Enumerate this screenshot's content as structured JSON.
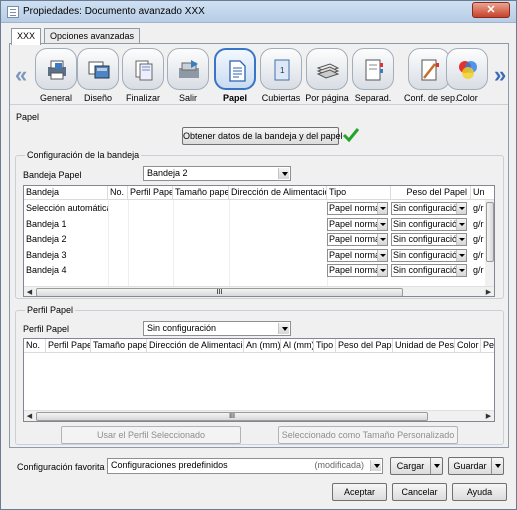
{
  "window": {
    "title": "Propiedades: Documento avanzado XXX",
    "close_label": "✕"
  },
  "tabs": [
    {
      "label": "XXX"
    },
    {
      "label": "Opciones avanzadas"
    }
  ],
  "icons": [
    {
      "label": "General",
      "icon": "printer-icon"
    },
    {
      "label": "Diseño",
      "icon": "layout-icon"
    },
    {
      "label": "Finalizar",
      "icon": "finishing-icon"
    },
    {
      "label": "Salir",
      "icon": "output-icon"
    },
    {
      "label": "Papel",
      "icon": "paper-icon"
    },
    {
      "label": "Cubiertas",
      "icon": "covers-icon"
    },
    {
      "label": "Por página",
      "icon": "per-page-icon"
    },
    {
      "label": "Separad.",
      "icon": "separator-icon"
    },
    {
      "label": "Conf. de sep.",
      "icon": "separator-settings-icon"
    },
    {
      "label": "Color",
      "icon": "color-icon"
    }
  ],
  "paper": {
    "section_label": "Papel",
    "get_tray_button": "Obtener datos de la bandeja y del papel",
    "tray_config_label": "Configuración de la bandeja",
    "tray_paper_label": "Bandeja Papel",
    "tray_paper_value": "Bandeja  2",
    "tray_columns": [
      "Bandeja",
      "No.",
      "Perfil Papel",
      "Tamaño papel",
      "Dirección de Alimentación",
      "Tipo",
      "Peso del Papel",
      "Un"
    ],
    "tray_rows": [
      {
        "bandeja": "Selección automática",
        "tipo": "Papel normal",
        "peso": "Sin configuración",
        "unidad": "g/r"
      },
      {
        "bandeja": "Bandeja 1",
        "tipo": "Papel normal",
        "peso": "Sin configuración",
        "unidad": "g/r"
      },
      {
        "bandeja": "Bandeja 2",
        "tipo": "Papel normal",
        "peso": "Sin configuración",
        "unidad": "g/r"
      },
      {
        "bandeja": "Bandeja 3",
        "tipo": "Papel normal",
        "peso": "Sin configuración",
        "unidad": "g/r"
      },
      {
        "bandeja": "Bandeja 4",
        "tipo": "Papel normal",
        "peso": "Sin configuración",
        "unidad": "g/r"
      }
    ],
    "scroll_grip": "III"
  },
  "profile": {
    "section_label": "Perfil Papel",
    "profile_label": "Perfil Papel",
    "profile_value": "Sin configuración",
    "columns": [
      "No.",
      "Perfil Papel",
      "Tamaño papel",
      "Dirección de Alimentación",
      "An (mm)",
      "Al (mm)",
      "Tipo",
      "Peso del Papel",
      "Unidad de Peso",
      "Color",
      "Per"
    ],
    "use_button": "Usar el Perfil Seleccionado",
    "custom_button": "Seleccionado como Tamaño Personalizado",
    "scroll_grip": "III"
  },
  "footer": {
    "favorite_label": "Configuración favorita",
    "favorite_value": "Configuraciones predefinidos",
    "favorite_modified": "(modificada)",
    "load_button": "Cargar",
    "save_button": "Guardar",
    "accept_button": "Aceptar",
    "cancel_button": "Cancelar",
    "help_button": "Ayuda"
  }
}
